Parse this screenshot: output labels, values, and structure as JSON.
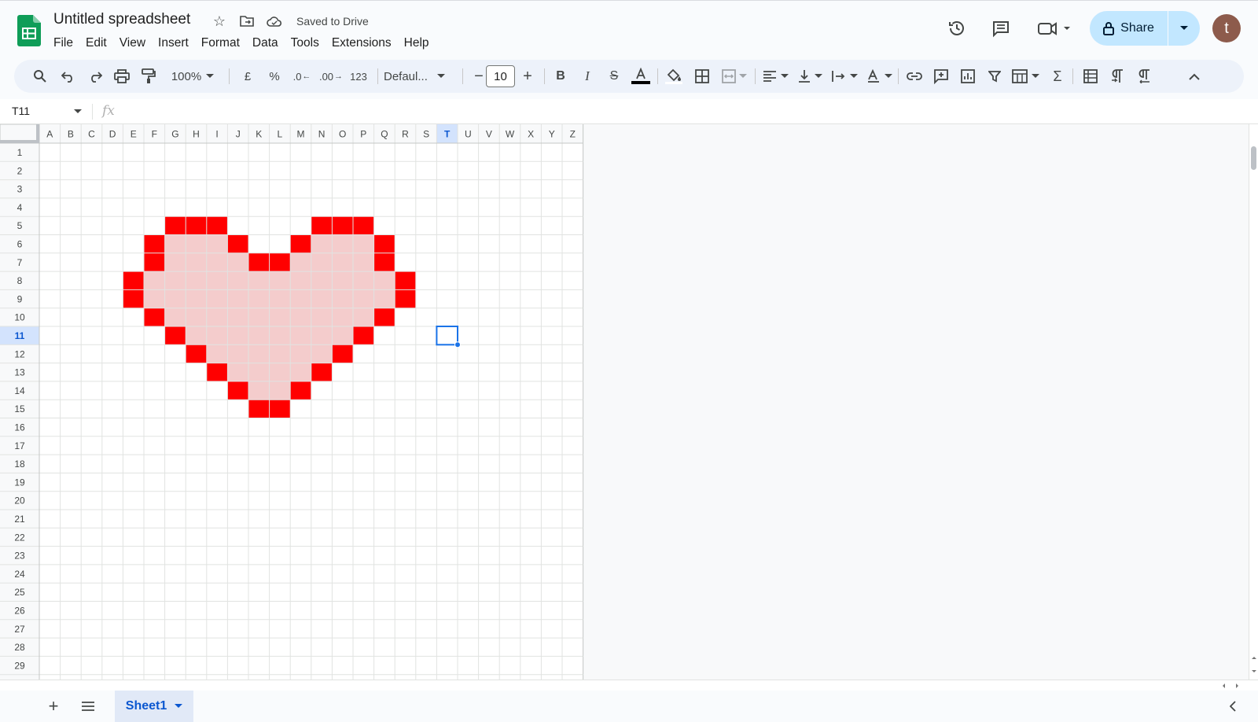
{
  "app": {
    "title": "Untitled spreadsheet",
    "saved_status": "Saved to Drive",
    "menu": [
      "File",
      "Edit",
      "View",
      "Insert",
      "Format",
      "Data",
      "Tools",
      "Extensions",
      "Help"
    ],
    "share_label": "Share",
    "avatar_letter": "t"
  },
  "toolbar": {
    "zoom": "100%",
    "currency": "£",
    "percent": "%",
    "dec_decrease": ".0",
    "dec_increase": ".00",
    "number_format": "123",
    "font": "Defaul...",
    "font_size": "10"
  },
  "formula_bar": {
    "name_box": "T11",
    "fx": "fx",
    "value": ""
  },
  "grid": {
    "columns": [
      "A",
      "B",
      "C",
      "D",
      "E",
      "F",
      "G",
      "H",
      "I",
      "J",
      "K",
      "L",
      "M",
      "N",
      "O",
      "P",
      "Q",
      "R",
      "S",
      "T",
      "U",
      "V",
      "W",
      "X",
      "Y",
      "Z"
    ],
    "rows": [
      "1",
      "2",
      "3",
      "4",
      "5",
      "6",
      "7",
      "8",
      "9",
      "10",
      "11",
      "12",
      "13",
      "14",
      "15",
      "16",
      "17",
      "18",
      "19",
      "20",
      "21",
      "22",
      "23",
      "24",
      "25",
      "26",
      "27",
      "28",
      "29"
    ],
    "active_column": "T",
    "active_row": "11",
    "selected_cell": "T11",
    "colors": {
      "border": "#ff0000",
      "fill": "#f4cccc",
      "selection": "#1a73e8",
      "active_header": "#d3e3fd"
    },
    "border_cells": [
      "G5",
      "H5",
      "I5",
      "N5",
      "O5",
      "P5",
      "F6",
      "J6",
      "M6",
      "Q6",
      "F7",
      "K7",
      "L7",
      "Q7",
      "E8",
      "R8",
      "E9",
      "R9",
      "F10",
      "Q10",
      "G11",
      "P11",
      "H12",
      "O12",
      "I13",
      "N13",
      "J14",
      "M14",
      "K15",
      "L15"
    ],
    "fill_cells": [
      "G6",
      "H6",
      "I6",
      "N6",
      "O6",
      "P6",
      "G7",
      "H7",
      "I7",
      "J7",
      "M7",
      "N7",
      "O7",
      "P7",
      "F8",
      "G8",
      "H8",
      "I8",
      "J8",
      "K8",
      "L8",
      "M8",
      "N8",
      "O8",
      "P8",
      "Q8",
      "F9",
      "G9",
      "H9",
      "I9",
      "J9",
      "K9",
      "L9",
      "M9",
      "N9",
      "O9",
      "P9",
      "Q9",
      "G10",
      "H10",
      "I10",
      "J10",
      "K10",
      "L10",
      "M10",
      "N10",
      "O10",
      "P10",
      "H11",
      "I11",
      "J11",
      "K11",
      "L11",
      "M11",
      "N11",
      "O11",
      "I12",
      "J12",
      "K12",
      "L12",
      "M12",
      "N12",
      "J13",
      "K13",
      "L13",
      "M13",
      "K14",
      "L14"
    ]
  },
  "sheets": [
    {
      "name": "Sheet1",
      "active": true
    }
  ]
}
